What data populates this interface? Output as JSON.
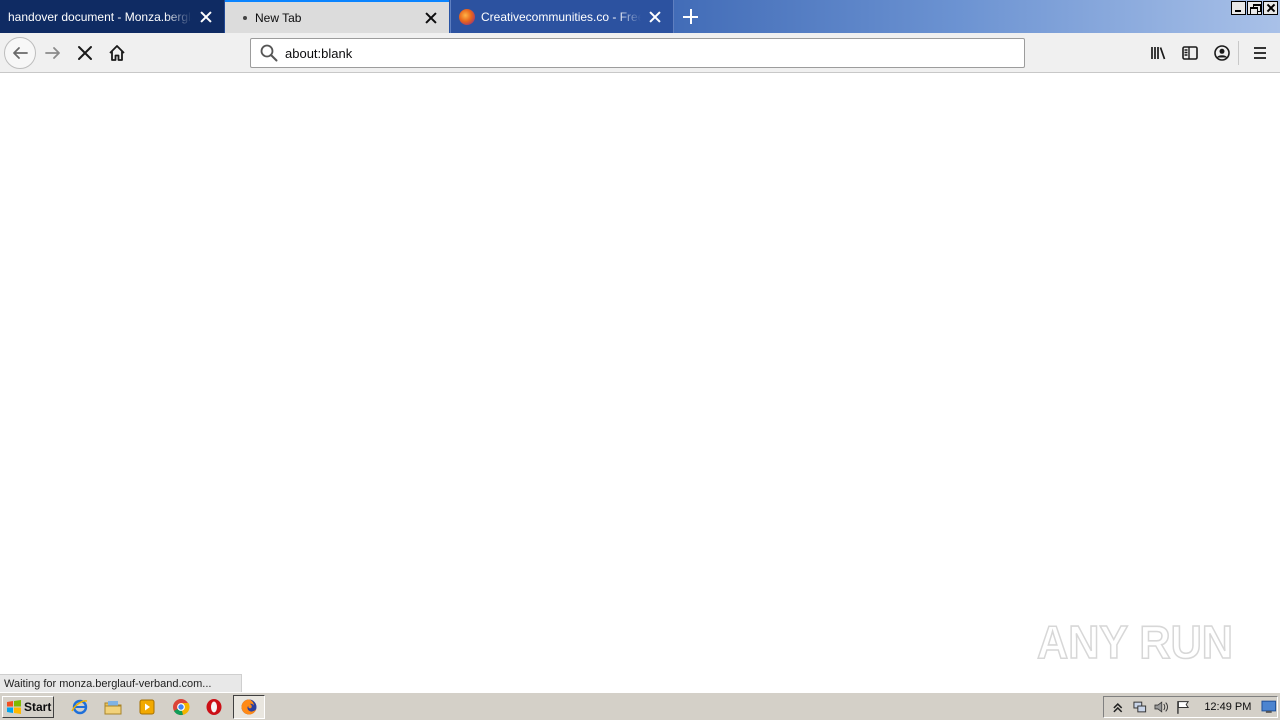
{
  "tabs": [
    {
      "title": "handover document - Monza.berglauf-",
      "active": false
    },
    {
      "title": "New Tab",
      "active": true
    },
    {
      "title": "Creativecommunities.co - Free All",
      "active": false
    }
  ],
  "urlbar": {
    "value": "about:blank"
  },
  "status": {
    "text": "Waiting for monza.berglauf-verband.com..."
  },
  "watermark": {
    "text": "ANY RUN"
  },
  "taskbar": {
    "start_label": "Start",
    "clock": "12:49 PM"
  },
  "icons": {
    "back": "arrow-left-icon",
    "forward": "arrow-right-icon",
    "stop": "close-icon",
    "home": "home-icon",
    "search": "search-icon",
    "library": "library-icon",
    "sidebar": "sidebar-icon",
    "account": "account-icon",
    "menu": "hamburger-icon"
  },
  "colors": {
    "accent": "#0a84ff",
    "tabstrip": "#2a56a8",
    "active_tab": "#dcdcdc"
  }
}
